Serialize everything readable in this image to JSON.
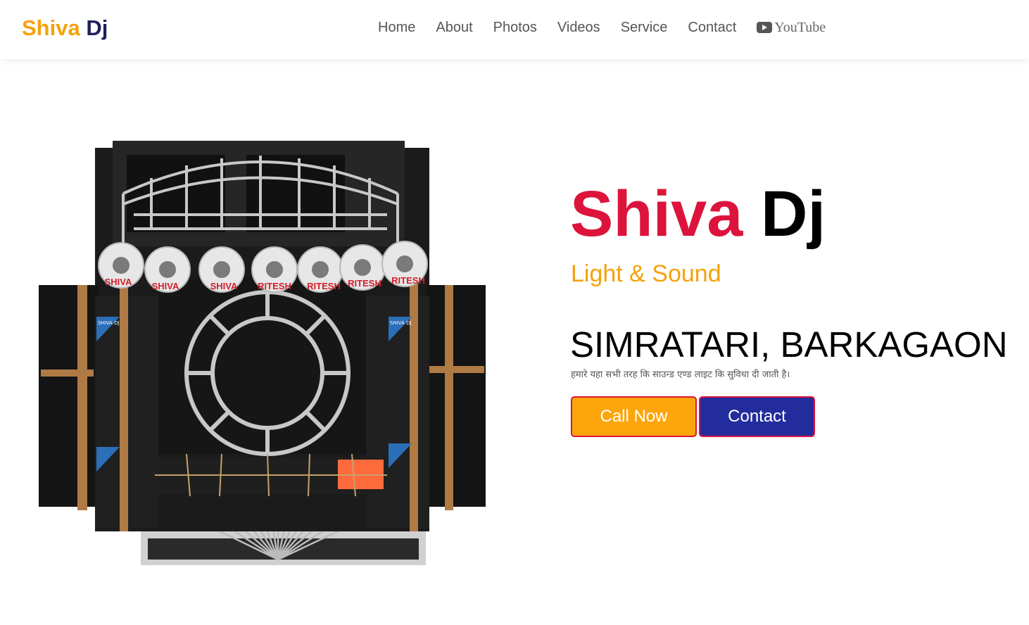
{
  "brand": {
    "part1": "Shiva",
    "part2": "Dj"
  },
  "nav": {
    "items": [
      "Home",
      "About",
      "Photos",
      "Videos",
      "Service",
      "Contact"
    ],
    "youtube_label": "YouTube",
    "youtube_icon": "youtube-icon"
  },
  "hero": {
    "title_part1": "Shiva",
    "title_part2": "Dj",
    "subtitle": "Light & Sound",
    "location": "SIMRATARI, BARKAGAON",
    "description": "हमारे यहा सभी तरह कि साउन्ड एण्ड लाइट कि सुविधा दी जाती है।",
    "call_button": "Call Now",
    "contact_button": "Contact",
    "image_labels": {
      "horn_texts": [
        "SHIVA",
        "SHIVA",
        "SHIVA",
        "RITESH",
        "RITESH",
        "RITESH",
        "RITESH"
      ],
      "panel_logo": "SHIVA DJ"
    }
  },
  "colors": {
    "brand_orange": "#f5a10b",
    "brand_navy": "#1f1f5c",
    "title_red": "#dc143c",
    "call_button_bg": "#fca60b",
    "contact_button_bg": "#232c9c"
  }
}
